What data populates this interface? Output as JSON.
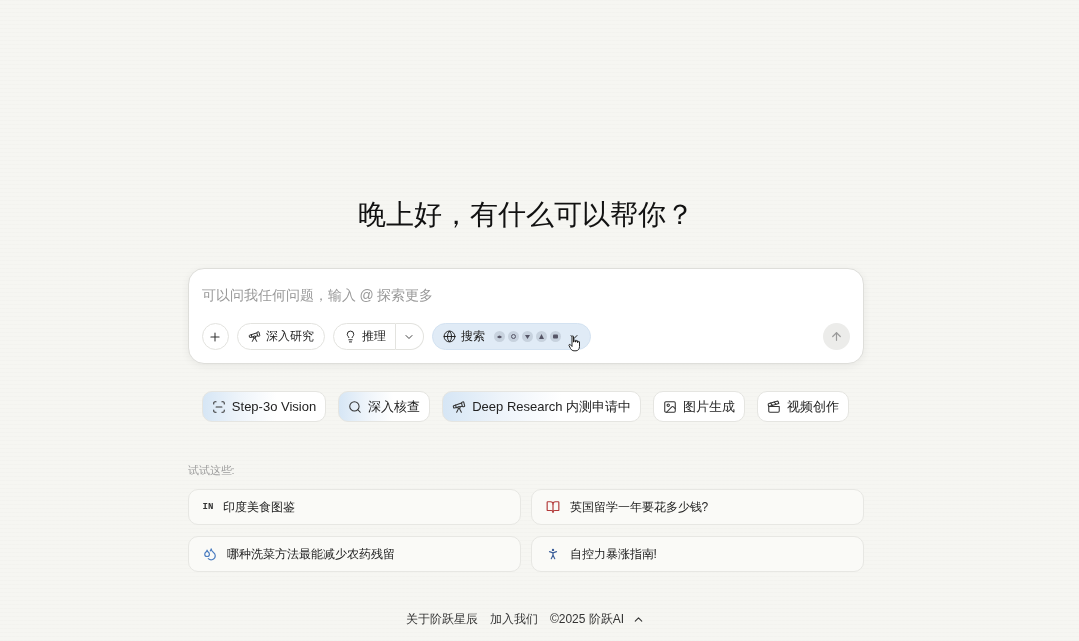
{
  "greeting": "晚上好，有什么可以帮你？",
  "composer": {
    "placeholder": "可以问我任何问题，输入 @ 探索更多",
    "tools": [
      {
        "kind": "research",
        "label": "深入研究",
        "selected": false
      },
      {
        "kind": "reasoning",
        "label": "推理",
        "selected": false
      },
      {
        "kind": "search",
        "label": "搜索",
        "selected": true
      }
    ],
    "send": {
      "disabled": true
    }
  },
  "features": [
    {
      "label": "Step-3o Vision",
      "highlighted": true
    },
    {
      "label": "深入核查",
      "highlighted": true
    },
    {
      "label": "Deep Research 内测申请中",
      "highlighted": true
    },
    {
      "label": "图片生成",
      "highlighted": false
    },
    {
      "label": "视频创作",
      "highlighted": false
    }
  ],
  "suggestions": {
    "title": "试试这些:",
    "items": [
      {
        "badge": "IN",
        "text": "印度美食图鉴"
      },
      {
        "text": "英国留学一年要花多少钱?"
      },
      {
        "text": "哪种洗菜方法最能减少农药残留"
      },
      {
        "text": "自控力暴涨指南!"
      }
    ]
  },
  "footer": {
    "links": [
      "关于阶跃星辰",
      "加入我们",
      "©2025 阶跃AI"
    ]
  }
}
